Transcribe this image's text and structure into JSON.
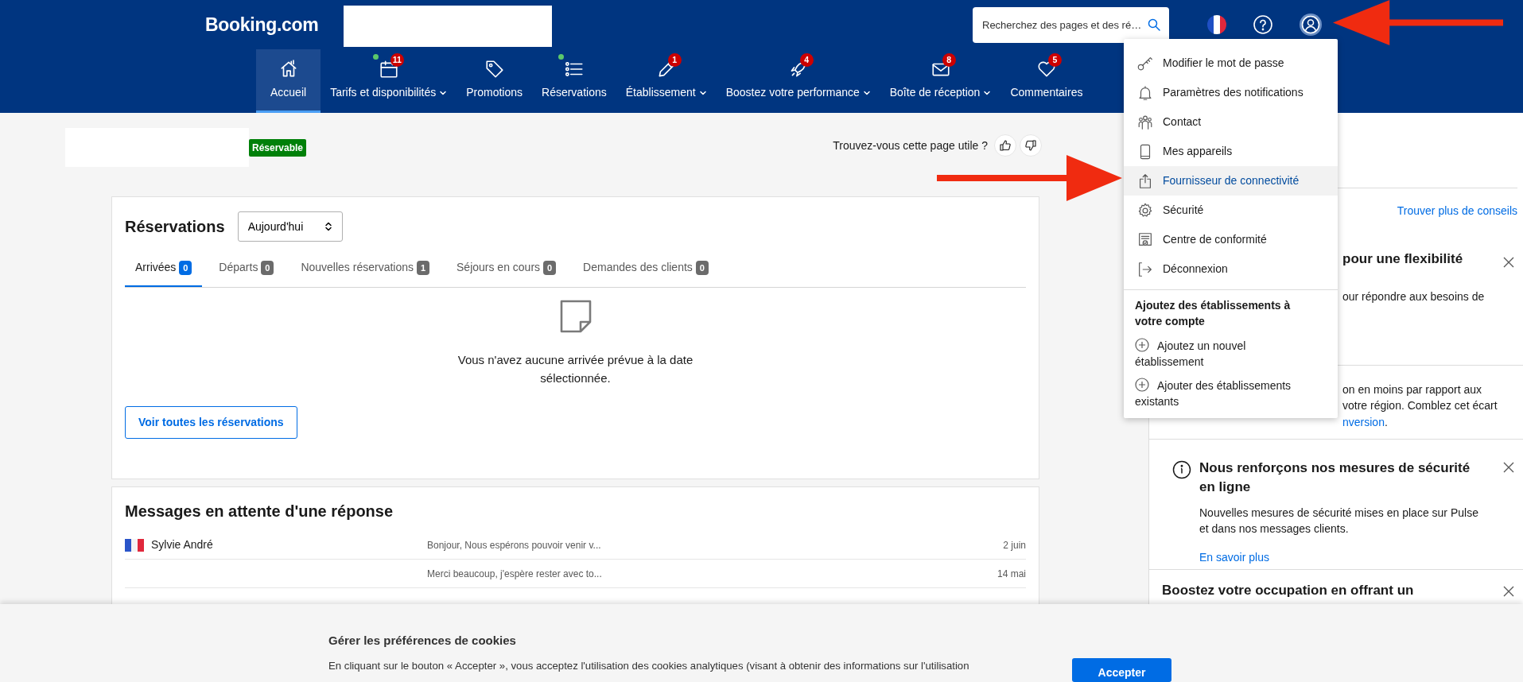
{
  "header": {
    "logo": "Booking.com",
    "search": {
      "placeholder": "Recherchez des pages et des ré…"
    }
  },
  "nav": [
    {
      "label": "Accueil",
      "selected": true,
      "dot": false,
      "has_menu": false
    },
    {
      "label": "Tarifs et disponibilités",
      "selected": false,
      "dot": true,
      "badge": "11",
      "has_menu": true
    },
    {
      "label": "Promotions",
      "selected": false,
      "dot": false,
      "has_menu": false
    },
    {
      "label": "Réservations",
      "selected": false,
      "dot": true,
      "has_menu": false
    },
    {
      "label": "Établissement",
      "selected": false,
      "dot": false,
      "badge": "1",
      "has_menu": true
    },
    {
      "label": "Boostez votre performance",
      "selected": false,
      "dot": false,
      "badge": "4",
      "has_menu": true
    },
    {
      "label": "Boîte de réception",
      "selected": false,
      "dot": false,
      "badge": "8",
      "has_menu": true
    },
    {
      "label": "Commentaires",
      "selected": false,
      "dot": false,
      "badge": "5",
      "has_menu": false
    }
  ],
  "page": {
    "status_badge": "Réservable",
    "feedback_question": "Trouvez-vous cette page utile ?"
  },
  "reservations": {
    "title": "Réservations",
    "filter": {
      "value": "Aujourd'hui"
    },
    "tabs": [
      {
        "label": "Arrivées",
        "count": "0",
        "selected": true
      },
      {
        "label": "Départs",
        "count": "0",
        "selected": false
      },
      {
        "label": "Nouvelles réservations",
        "count": "1",
        "selected": false
      },
      {
        "label": "Séjours en cours",
        "count": "0",
        "selected": false
      },
      {
        "label": "Demandes des clients",
        "count": "0",
        "selected": false
      }
    ],
    "empty_message": "Vous n'avez aucune arrivée prévue à la date sélectionnée.",
    "button": "Voir toutes les réservations"
  },
  "messages": {
    "title": "Messages en attente d'une réponse",
    "rows": [
      {
        "guest": "Sylvie André",
        "preview": "Bonjour, Nous espérons pouvoir venir v...",
        "date": "2 juin"
      },
      {
        "preview": "Merci beaucoup, j'espère rester avec to...",
        "date": "14 mai"
      }
    ]
  },
  "right_panel": {
    "link": "Trouver plus de conseils",
    "tips": [
      {
        "kind": "partial",
        "title": "pour une flexibilité",
        "lines": [
          "our répondre aux besoins de"
        ],
        "closable": true
      },
      {
        "kind": "partial",
        "lines": [
          "on en moins par rapport aux",
          "votre région. Comblez cet écart"
        ],
        "link": "nversion",
        "after_link": ".",
        "closable": false
      },
      {
        "kind": "info",
        "title": "Nous renforçons nos mesures de sécurité en ligne",
        "body": "Nouvelles mesures de sécurité mises en place sur Pulse et dans nos messages clients.",
        "link": "En savoir plus",
        "closable": true
      },
      {
        "kind": "partial",
        "title": "Boostez votre occupation en offrant un",
        "closable": true
      }
    ]
  },
  "user_menu": {
    "items": [
      {
        "label": "Modifier le mot de passe",
        "selected": false
      },
      {
        "label": "Paramètres des notifications",
        "selected": false
      },
      {
        "label": "Contact",
        "selected": false
      },
      {
        "label": "Mes appareils",
        "selected": false
      },
      {
        "label": "Fournisseur de connectivité",
        "selected": true
      },
      {
        "label": "Sécurité",
        "selected": false
      },
      {
        "label": "Centre de conformité",
        "selected": false
      },
      {
        "label": "Déconnexion",
        "selected": false
      }
    ],
    "section_title": "Ajoutez des établissements à votre compte",
    "add_items": [
      "Ajoutez un nouvel établissement",
      "Ajouter des établissements existants"
    ]
  },
  "cookie_banner": {
    "title": "Gérer les préférences de cookies",
    "text": "En cliquant sur le bouton « Accepter », vous acceptez l'utilisation des cookies analytiques (visant à obtenir des informations sur l'utilisation",
    "button": "Accepter"
  }
}
